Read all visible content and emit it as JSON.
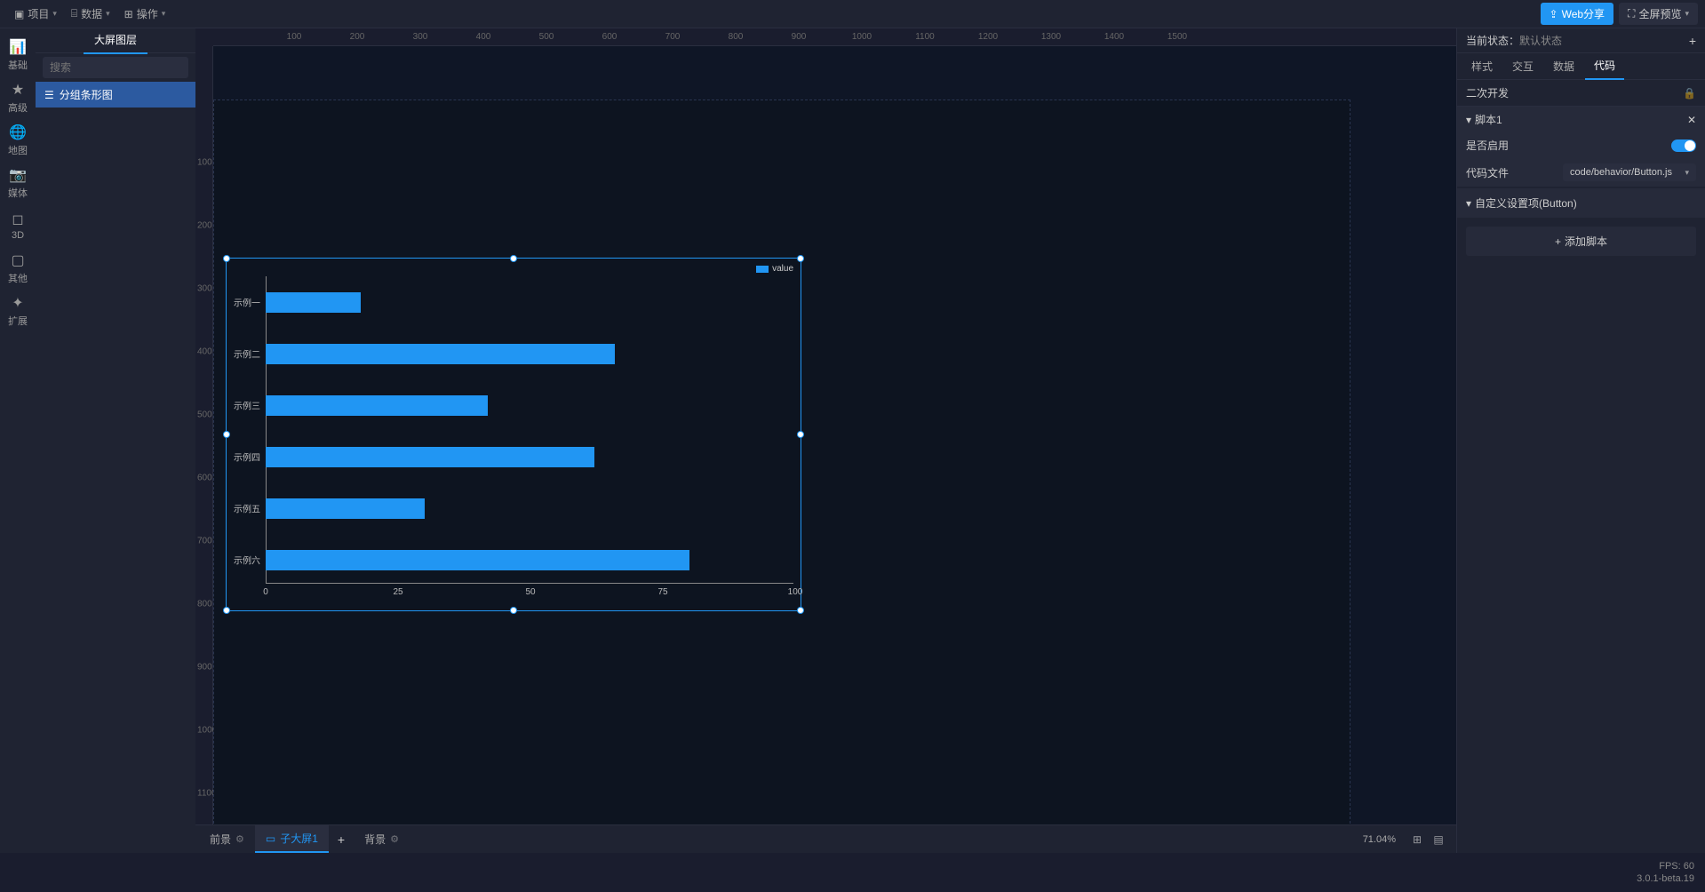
{
  "toolbar": {
    "project": "项目",
    "data": "数据",
    "operation": "操作",
    "web_share": "Web分享",
    "fullscreen": "全屏预览"
  },
  "icon_sidebar": [
    {
      "label": "基础"
    },
    {
      "label": "高级"
    },
    {
      "label": "地图"
    },
    {
      "label": "媒体"
    },
    {
      "label": "3D"
    },
    {
      "label": "其他"
    },
    {
      "label": "扩展"
    }
  ],
  "layers": {
    "tab": "大屏图层",
    "search_placeholder": "搜索",
    "items": [
      {
        "label": "分组条形图"
      }
    ]
  },
  "canvas": {
    "ruler_h": [
      100,
      200,
      300,
      400,
      500,
      600,
      700,
      800,
      900,
      1000,
      1100,
      1200,
      1300,
      1400,
      1500
    ],
    "ruler_v": [
      100,
      200,
      300,
      400,
      500,
      600,
      700,
      800,
      900,
      1000,
      1100
    ]
  },
  "chart_data": {
    "type": "bar",
    "orientation": "horizontal",
    "categories": [
      "示例一",
      "示例二",
      "示例三",
      "示例四",
      "示例五",
      "示例六"
    ],
    "values": [
      18,
      66,
      42,
      62,
      30,
      80
    ],
    "series": [
      {
        "name": "value",
        "values": [
          18,
          66,
          42,
          62,
          30,
          80
        ]
      }
    ],
    "legend": "value",
    "xlabel": "",
    "ylabel": "",
    "xlim": [
      0,
      100
    ],
    "x_ticks": [
      0,
      25,
      50,
      75,
      100
    ],
    "bar_color": "#2196f3"
  },
  "props": {
    "state_label": "当前状态：",
    "state_value": "默认状态",
    "tabs": [
      "样式",
      "交互",
      "数据",
      "代码"
    ],
    "active_tab": 3,
    "section_title": "二次开发",
    "script": {
      "title": "脚本1",
      "enable_label": "是否启用",
      "enabled": true,
      "code_label": "代码文件",
      "code_file": "code/behavior/Button.js",
      "custom_settings": "自定义设置项(Button)"
    },
    "add_script": "添加脚本"
  },
  "bottom": {
    "tabs": [
      {
        "label": "前景"
      },
      {
        "label": "子大屏1",
        "active": true
      },
      {
        "label": "背景"
      }
    ],
    "zoom": "71.04%"
  },
  "status": {
    "fps": "FPS: 60",
    "version": "3.0.1-beta.19"
  }
}
